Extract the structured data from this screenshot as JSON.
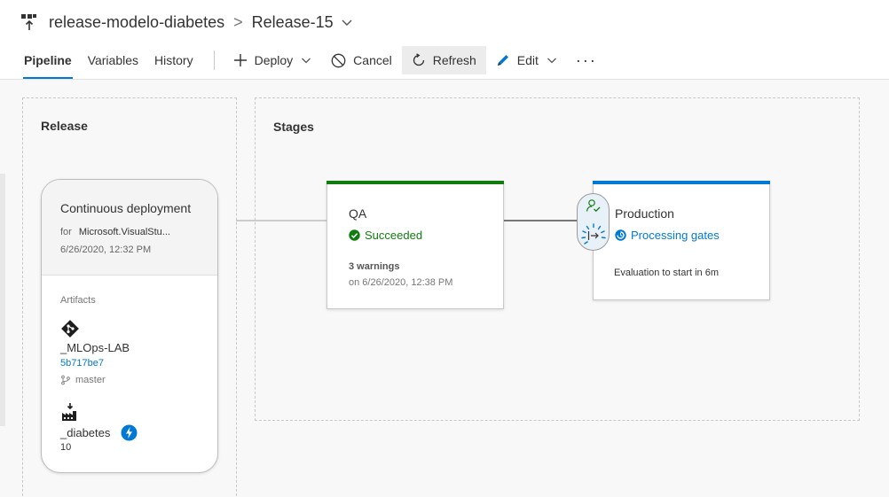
{
  "header": {
    "breadcrumb_pipeline": "release-modelo-diabetes",
    "breadcrumb_separator": ">",
    "breadcrumb_release": "Release-15"
  },
  "tabs": [
    {
      "label": "Pipeline",
      "active": true
    },
    {
      "label": "Variables",
      "active": false
    },
    {
      "label": "History",
      "active": false
    }
  ],
  "commands": {
    "deploy": "Deploy",
    "cancel": "Cancel",
    "refresh": "Refresh",
    "edit": "Edit",
    "more": "···"
  },
  "release_panel": {
    "title": "Release",
    "card": {
      "trigger": "Continuous deployment",
      "for_label": "for",
      "source": "Microsoft.VisualStu...",
      "date": "6/26/2020, 12:32 PM",
      "artifacts_label": "Artifacts",
      "artifacts": [
        {
          "name": "_MLOps-LAB",
          "commit": "5b717be7",
          "branch": "master",
          "icon": "git-icon"
        },
        {
          "name": "_diabetes",
          "version": "10",
          "icon": "build-icon",
          "badge": "lightning-icon"
        }
      ]
    }
  },
  "stages_panel": {
    "title": "Stages",
    "stages": [
      {
        "name": "QA",
        "status": "Succeeded",
        "status_color": "#107c10",
        "warnings": "3 warnings",
        "date": "on 6/26/2020, 12:38 PM",
        "bar_color": "#107c10"
      },
      {
        "name": "Production",
        "status": "Processing gates",
        "status_color": "#0078d4",
        "note": "Evaluation to start in 6m",
        "bar_color": "#0078d4"
      }
    ]
  },
  "colors": {
    "accent": "#0078d4",
    "success": "#107c10"
  }
}
